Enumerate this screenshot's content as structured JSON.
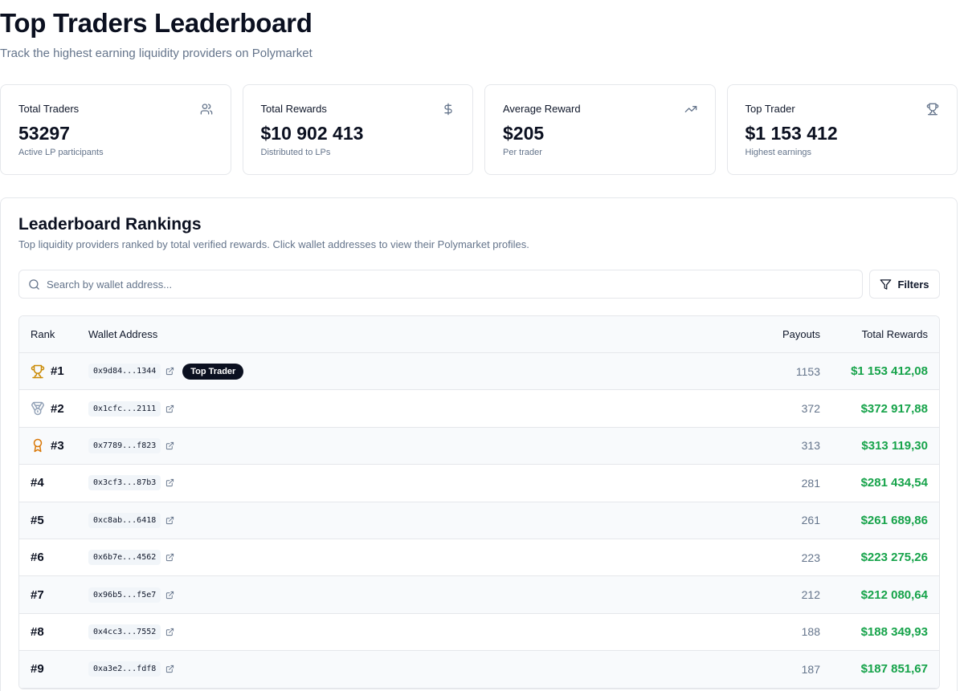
{
  "header": {
    "title": "Top Traders Leaderboard",
    "subtitle": "Track the highest earning liquidity providers on Polymarket"
  },
  "stats": [
    {
      "label": "Total Traders",
      "value": "53297",
      "caption": "Active LP participants",
      "icon": "users-icon"
    },
    {
      "label": "Total Rewards",
      "value": "$10 902 413",
      "caption": "Distributed to LPs",
      "icon": "dollar-icon"
    },
    {
      "label": "Average Reward",
      "value": "$205",
      "caption": "Per trader",
      "icon": "trending-up-icon"
    },
    {
      "label": "Top Trader",
      "value": "$1 153 412",
      "caption": "Highest earnings",
      "icon": "trophy-icon"
    }
  ],
  "board": {
    "title": "Leaderboard Rankings",
    "description": "Top liquidity providers ranked by total verified rewards. Click wallet addresses to view their Polymarket profiles.",
    "search_placeholder": "Search by wallet address...",
    "search_value": "",
    "filters_label": "Filters"
  },
  "table": {
    "headers": {
      "rank": "Rank",
      "wallet": "Wallet Address",
      "payouts": "Payouts",
      "rewards": "Total Rewards"
    },
    "rows": [
      {
        "rank": "#1",
        "wallet": "0x9d84...1344",
        "badge": "Top Trader",
        "payouts": "1153",
        "rewards": "$1 153 412,08",
        "icon": "trophy-icon"
      },
      {
        "rank": "#2",
        "wallet": "0x1cfc...2111",
        "payouts": "372",
        "rewards": "$372 917,88",
        "icon": "medal-icon"
      },
      {
        "rank": "#3",
        "wallet": "0x7789...f823",
        "payouts": "313",
        "rewards": "$313 119,30",
        "icon": "award-icon"
      },
      {
        "rank": "#4",
        "wallet": "0x3cf3...87b3",
        "payouts": "281",
        "rewards": "$281 434,54"
      },
      {
        "rank": "#5",
        "wallet": "0xc8ab...6418",
        "payouts": "261",
        "rewards": "$261 689,86"
      },
      {
        "rank": "#6",
        "wallet": "0x6b7e...4562",
        "payouts": "223",
        "rewards": "$223 275,26"
      },
      {
        "rank": "#7",
        "wallet": "0x96b5...f5e7",
        "payouts": "212",
        "rewards": "$212 080,64"
      },
      {
        "rank": "#8",
        "wallet": "0x4cc3...7552",
        "payouts": "188",
        "rewards": "$188 349,93"
      },
      {
        "rank": "#9",
        "wallet": "0xa3e2...fdf8",
        "payouts": "187",
        "rewards": "$187 851,67"
      }
    ]
  },
  "colors": {
    "gold": "#ca8a04",
    "silver": "#94a3b8",
    "bronze": "#d97706",
    "reward_green": "#16a34a"
  }
}
